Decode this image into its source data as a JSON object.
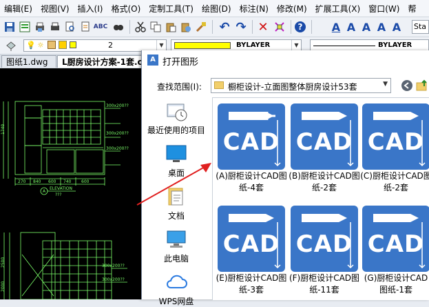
{
  "menu": [
    "编辑(E)",
    "视图(V)",
    "插入(I)",
    "格式(O)",
    "定制工具(T)",
    "绘图(D)",
    "标注(N)",
    "修改(M)",
    "扩展工具(X)",
    "窗口(W)",
    "帮"
  ],
  "toolbar": {
    "search_text": "Sta"
  },
  "layer": {
    "layer_name": "2",
    "color_value": "BYLAYER",
    "linetype_value": "BYLAYER"
  },
  "tabs": {
    "tab1": "图纸1.dwg",
    "tab2": "L厨房设计方案-1套.c"
  },
  "cad": {
    "dims": [
      "300x200??",
      "300x200??",
      "300x200??",
      "300x200??",
      "300x200??"
    ],
    "bottom_dims": [
      "270",
      "840",
      "600",
      "740",
      "600"
    ],
    "elevation_marker": "A",
    "elevation_label": "ELEVATION",
    "elevation_sub": "???",
    "side_dims": [
      "1740",
      "2500",
      "2000"
    ]
  },
  "dialog": {
    "title": "打开图形",
    "look_in_label": "查找范围(I):",
    "look_in_value": "橱柜设计-立面图整体厨房设计53套"
  },
  "places": [
    {
      "label": "最近使用的项目",
      "icon": "recent-items-icon"
    },
    {
      "label": "桌面",
      "icon": "desktop-icon"
    },
    {
      "label": "文档",
      "icon": "documents-icon"
    },
    {
      "label": "此电脑",
      "icon": "computer-icon"
    },
    {
      "label": "WPS网盘",
      "icon": "cloud-drive-icon"
    }
  ],
  "files": [
    {
      "line1": "(A)厨柜设计CAD图",
      "line2": "纸-4套",
      "icon_text": "CAD"
    },
    {
      "line1": "(B)厨柜设计CAD图",
      "line2": "纸-2套",
      "icon_text": "CAD"
    },
    {
      "line1": "(C)厨柜设计CAD图",
      "line2": "纸-2套",
      "icon_text": "CAD"
    },
    {
      "line1": "(E)厨柜设计CAD图",
      "line2": "纸-3套",
      "icon_text": "CAD"
    },
    {
      "line1": "(F)厨柜设计CAD图",
      "line2": "纸-11套",
      "icon_text": "CAD"
    },
    {
      "line1": "(G)厨柜设计CAD",
      "line2": "图纸-1套",
      "icon_text": "CAD"
    }
  ],
  "colors": {
    "accent": "#3a76c8",
    "canvas": "#000000",
    "cad_lines": "#7cff6a",
    "arrow": "#e02020",
    "layer_swatch": "#ffff00"
  }
}
